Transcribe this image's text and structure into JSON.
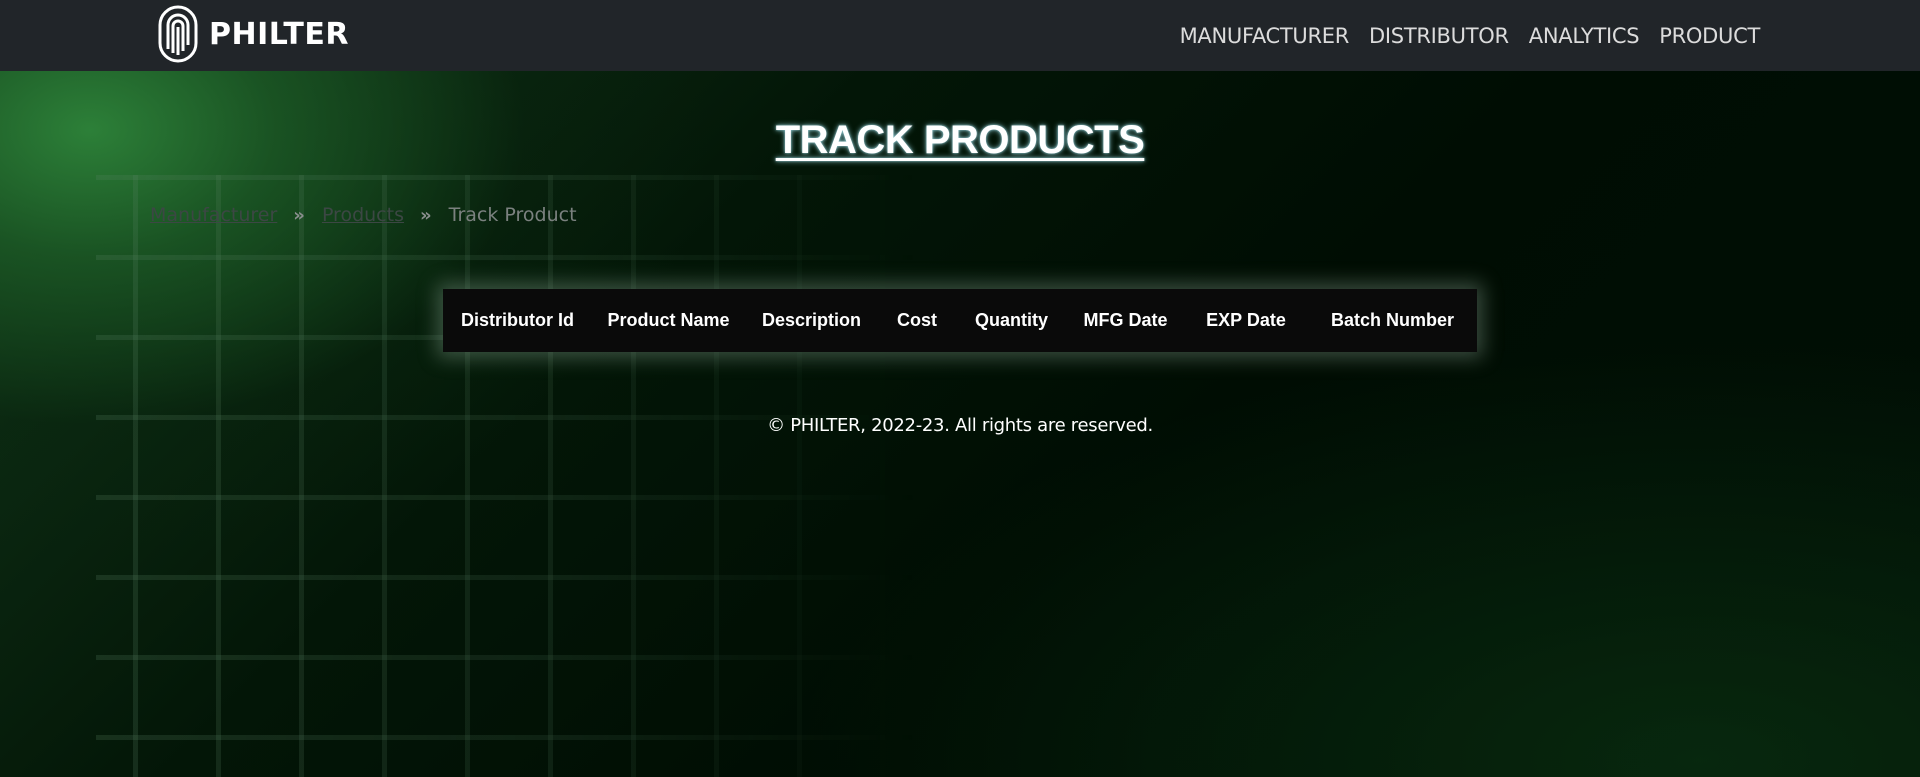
{
  "navbar": {
    "brand_name": "PHILTER",
    "links": [
      {
        "label": "MANUFACTURER"
      },
      {
        "label": "DISTRIBUTOR"
      },
      {
        "label": "ANALYTICS"
      },
      {
        "label": "PRODUCT"
      }
    ]
  },
  "page": {
    "title": "TRACK PRODUCTS"
  },
  "breadcrumb": {
    "items": [
      {
        "label": "Manufacturer"
      },
      {
        "label": "Products"
      },
      {
        "label": "Track Product"
      }
    ],
    "separator_icon": "double-chevron-right-icon",
    "separator": "»"
  },
  "table": {
    "headers": [
      "Distributor Id",
      "Product Name",
      "Description",
      "Cost",
      "Quantity",
      "MFG Date",
      "EXP Date",
      "Batch Number"
    ],
    "rows": []
  },
  "footer": {
    "text": "© PHILTER, 2022-23. All rights are reserved."
  },
  "colors": {
    "navbar_bg": "#212529",
    "accent_green": "#2e843a",
    "table_bg": "#0a0a0a"
  }
}
